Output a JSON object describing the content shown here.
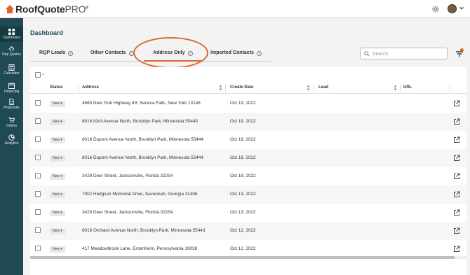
{
  "app": {
    "brand_main": "RoofQuote",
    "brand_pro": "PRO",
    "brand_mark": "®",
    "accent_color": "#e0632a",
    "sidebar_color": "#1f4a55"
  },
  "sidebar": {
    "items": [
      {
        "label": "Dashboard",
        "icon": "grid-icon"
      },
      {
        "label": "Rep Quotes",
        "icon": "roof-icon"
      },
      {
        "label": "Calculator",
        "icon": "calculator-icon"
      },
      {
        "label": "Financing",
        "icon": "calendar-icon"
      },
      {
        "label": "Proposals",
        "icon": "document-icon"
      },
      {
        "label": "Orders",
        "icon": "cart-icon"
      },
      {
        "label": "Analytics",
        "icon": "pie-icon"
      }
    ]
  },
  "page": {
    "title": "Dashboard"
  },
  "tabs": [
    {
      "label": "RQP Leads"
    },
    {
      "label": "Other Contacts"
    },
    {
      "label": "Address Only",
      "active": true
    },
    {
      "label": "Imported Contacts"
    }
  ],
  "search": {
    "placeholder": "Search",
    "value": ""
  },
  "table": {
    "bulk_caret": "⌄",
    "columns": [
      "Status",
      "Address",
      "Create Date",
      "Lead",
      "URL"
    ],
    "rows": [
      {
        "status": "New",
        "address": "4660 New York Highway 89, Seneca Falls, New York 13148",
        "date": "Oct 19, 2022"
      },
      {
        "status": "New",
        "address": "8016 83rd Avenue North, Brooklyn Park, Minnesota 55445",
        "date": "Oct 18, 2022"
      },
      {
        "status": "New",
        "address": "8016 Dupont Avenue North, Brooklyn Park, Minnesota 55444",
        "date": "Oct 18, 2022"
      },
      {
        "status": "New",
        "address": "8016 Dupont Avenue North, Brooklyn Park, Minnesota 55444",
        "date": "Oct 18, 2022"
      },
      {
        "status": "New",
        "address": "3429 Deer Street, Jacksonville, Florida 32254",
        "date": "Oct 18, 2022"
      },
      {
        "status": "New",
        "address": "7002 Hodgson Memorial Drive, Savannah, Georgia 31406",
        "date": "Oct 13, 2022"
      },
      {
        "status": "New",
        "address": "3429 Deer Street, Jacksonville, Florida 32254",
        "date": "Oct 13, 2022"
      },
      {
        "status": "New",
        "address": "8016 Orchard Avenue North, Brooklyn Park, Minnesota 55443",
        "date": "Oct 12, 2022"
      },
      {
        "status": "New",
        "address": "417 Meadowbrook Lane, Erdenheim, Pennsylvania 19038",
        "date": "Oct 12, 2022"
      }
    ]
  }
}
